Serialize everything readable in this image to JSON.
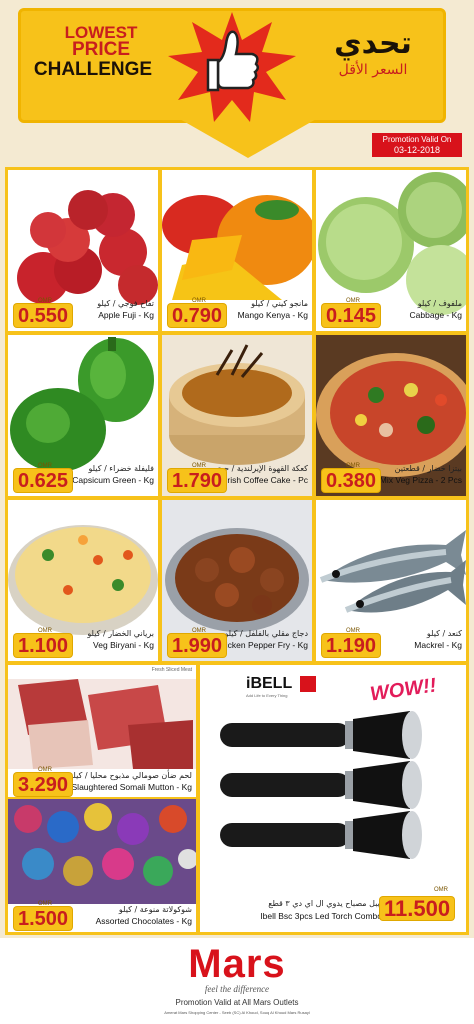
{
  "header": {
    "title_line1": "LOWEST",
    "title_line2": "PRICE",
    "title_line3": "CHALLENGE",
    "arabic_title": "تحدي",
    "arabic_subtitle": "السعر الأقل",
    "promo_label": "Promotion Valid On",
    "promo_date": "03-12-2018"
  },
  "currency_label": "OMR",
  "products": [
    {
      "en": "Apple Fuji - Kg",
      "ar": "تفاح فوجي / كيلو",
      "price": "0.550"
    },
    {
      "en": "Mango Kenya - Kg",
      "ar": "مانجو كيني / كيلو",
      "price": "0.790"
    },
    {
      "en": "Cabbage - Kg",
      "ar": "ملفوف / كيلو",
      "price": "0.145"
    },
    {
      "en": "Capsicum Green - Kg",
      "ar": "فليفلة خضراء / كيلو",
      "price": "0.625"
    },
    {
      "en": "Irish Coffee Cake - Pc",
      "ar": "كعكة القهوة الإيرلندية / حبة",
      "price": "1.790"
    },
    {
      "en": "Mix Veg Pizza - 2 Pcs",
      "ar": "بيتزا خضار / قطعتين",
      "price": "0.380"
    },
    {
      "en": "Veg Biryani - Kg",
      "ar": "برياني الخضار / كيلو",
      "price": "1.100"
    },
    {
      "en": "Chicken Pepper Fry - Kg",
      "ar": "دجاج مقلي بالفلفل / كيلو",
      "price": "1.990"
    },
    {
      "en": "Mackrel - Kg",
      "ar": "كنعد / كيلو",
      "price": "1.190"
    },
    {
      "en": "Local Slaughtered Somali Mutton - Kg",
      "ar": "لحم ضأن صومالي مذبوح محليا / كيلو",
      "price": "3.290"
    },
    {
      "en": "Assorted Chocolates - Kg",
      "ar": "شوكولاتة منوعة / كيلو",
      "price": "1.500"
    },
    {
      "en": "Ibell Bsc 3pcs Led Torch Combo",
      "ar": "ايبل مصباح يدوي ال اي دي ٣ قطع",
      "price": "11.500"
    }
  ],
  "mutton_badge": "Fresh Sliced Meat",
  "torch": {
    "brand": "iBELL",
    "brand_sub": "Add Life to Every Thing",
    "wow": "WOW!!"
  },
  "footer": {
    "brand": "Mars",
    "tagline": "feel the difference",
    "valid": "Promotion Valid at All Mars Outlets",
    "address": "Amerat Mars Shopping Center - Seeb (SC) Al Khoud, Souq Al Khoud Mars Rusayl"
  },
  "colors": {
    "accent": "#f7c21a",
    "brand_red": "#d8121b",
    "price_red": "#c81e1e"
  }
}
